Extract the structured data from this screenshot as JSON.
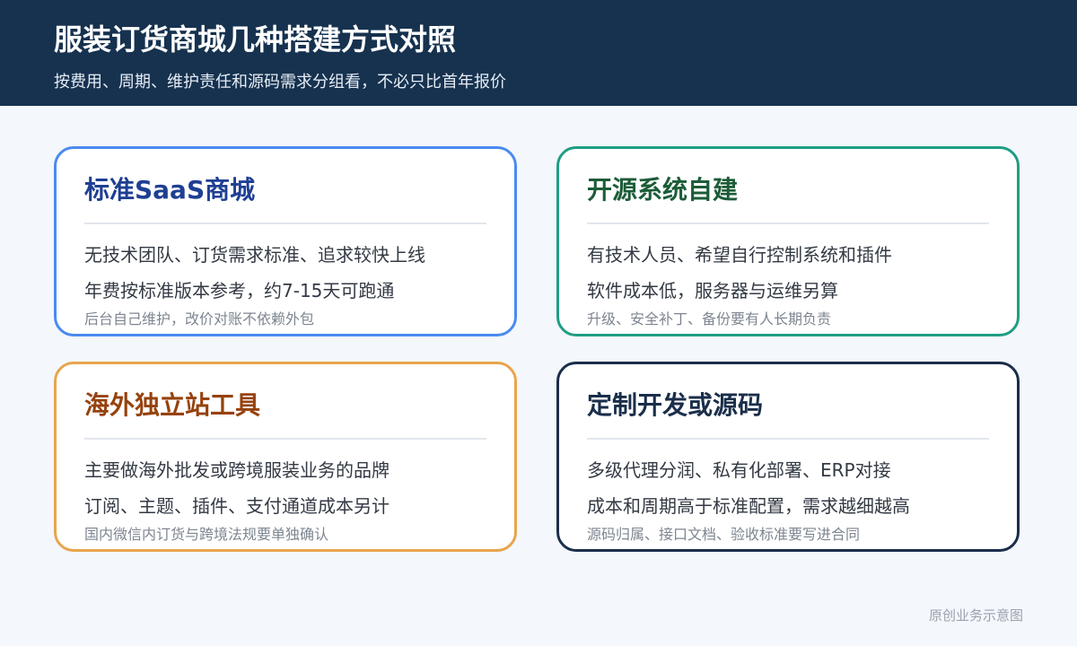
{
  "header": {
    "title": "服装订货商城几种搭建方式对照",
    "subtitle": "按费用、周期、维护责任和源码需求分组看，不必只比首年报价",
    "background_color": "#16324f"
  },
  "cards": [
    {
      "title": "标准SaaS商城",
      "lines": [
        "无技术团队、订货需求标准、追求较快上线",
        "年费按标准版本参考，约7-15天可跑通"
      ],
      "note": "后台自己维护，改价对账不依赖外包",
      "border_color": "#4a8af0",
      "title_color": "#1f3f93"
    },
    {
      "title": "开源系统自建",
      "lines": [
        "有技术人员、希望自行控制系统和插件",
        "软件成本低，服务器与运维另算"
      ],
      "note": "升级、安全补丁、备份要有人长期负责",
      "border_color": "#1f9e84",
      "title_color": "#1c5c38"
    },
    {
      "title": "海外独立站工具",
      "lines": [
        "主要做海外批发或跨境服装业务的品牌",
        "订阅、主题、插件、支付通道成本另计"
      ],
      "note": "国内微信内订货与跨境法规要单独确认",
      "border_color": "#e8a54c",
      "title_color": "#96420e"
    },
    {
      "title": "定制开发或源码",
      "lines": [
        "多级代理分润、私有化部署、ERP对接",
        "成本和周期高于标准配置，需求越细越高"
      ],
      "note": "源码归属、接口文档、验收标准要写进合同",
      "border_color": "#1a2e4a",
      "title_color": "#1a2e4a"
    }
  ],
  "footer": {
    "note": "原创业务示意图"
  }
}
